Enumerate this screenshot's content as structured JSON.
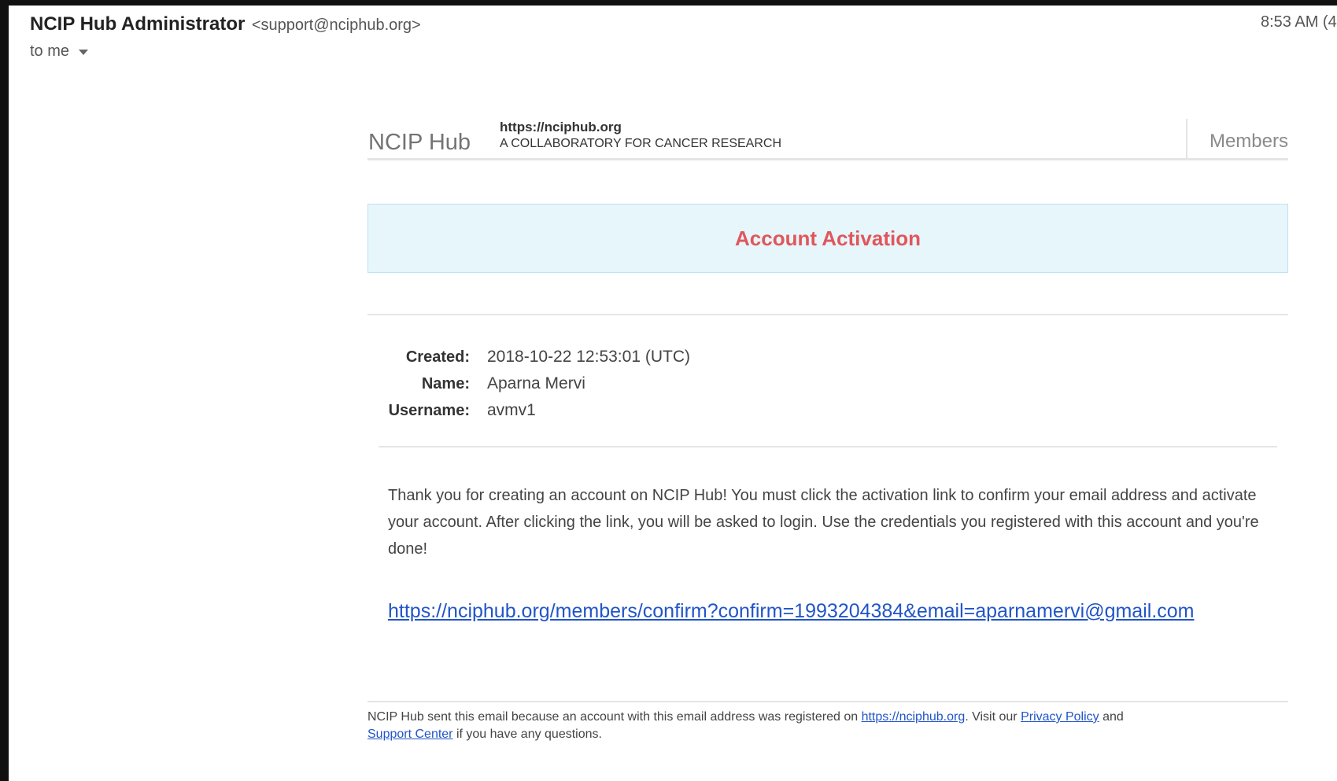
{
  "email": {
    "sender_name": "NCIP Hub Administrator",
    "sender_email": "<support@nciphub.org>",
    "timestamp": "8:53 AM (4",
    "recipient": "to me"
  },
  "site": {
    "brand": "NCIP Hub",
    "url": "https://nciphub.org",
    "tagline": "A COLLABORATORY FOR CANCER RESEARCH",
    "nav_members": "Members"
  },
  "banner": {
    "title": "Account Activation"
  },
  "details": [
    {
      "label": "Created:",
      "value": "2018-10-22 12:53:01 (UTC)"
    },
    {
      "label": "Name:",
      "value": "Aparna Mervi"
    },
    {
      "label": "Username:",
      "value": "avmv1"
    }
  ],
  "message": {
    "body": "Thank you for creating an account on NCIP Hub! You must click the activation link to confirm your email address and activate your account. After clicking the link, you will be asked to login. Use the credentials you registered with this account and you're done!",
    "activation_link": "https://nciphub.org/members/confirm?confirm=1993204384&email=aparnamervi@gmail.com"
  },
  "footer": {
    "text_1": "NCIP Hub sent this email because an account with this email address was registered on ",
    "link_site": "https://nciphub.org",
    "text_2": ". Visit our ",
    "link_privacy": "Privacy Policy",
    "text_3": " and ",
    "link_support": "Support Center",
    "text_4": " if you have any questions."
  },
  "colors": {
    "banner_bg": "#e6f6fb",
    "banner_title": "#e0575b",
    "link": "#2155c7"
  }
}
